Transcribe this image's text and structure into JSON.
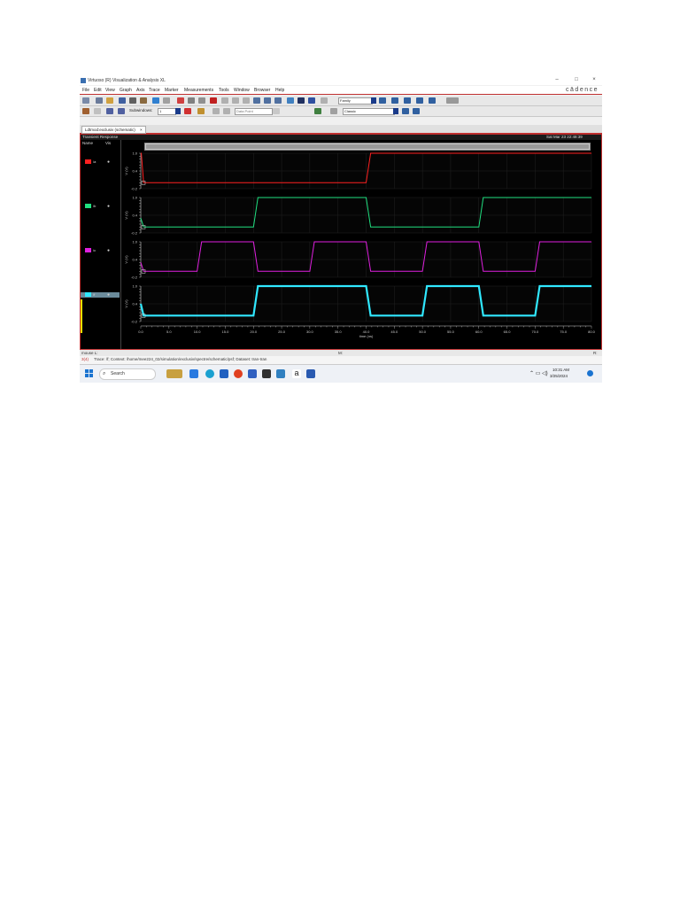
{
  "window": {
    "title": "Virtuoso (R) Visualization & Analysis XL",
    "controls": [
      "–",
      "□",
      "×"
    ]
  },
  "menu": {
    "items": [
      "File",
      "Edit",
      "View",
      "Graph",
      "Axis",
      "Trace",
      "Marker",
      "Measurements",
      "Tools",
      "Window",
      "Browser",
      "Help"
    ],
    "brand": "cādence"
  },
  "toolbar2": {
    "subwindows_label": "Subwindows:",
    "subwindows_value": "1",
    "point_placeholder": "Data Point",
    "family_value": "Family",
    "classic_value": "Classic"
  },
  "tab": {
    "label": "Ldtmod:exclusiv (schematic)",
    "close": "×"
  },
  "graph": {
    "title": "Transient Response",
    "timestamp": "Sat Mar 23 22:48:39",
    "side_headers": [
      "Name",
      "Vis"
    ],
    "x_label": "time (ns)",
    "x_ticks": [
      "0.0",
      "5.0",
      "10.0",
      "15.0",
      "20.0",
      "25.0",
      "30.0",
      "35.0",
      "40.0",
      "45.0",
      "50.0",
      "55.0",
      "60.0",
      "65.0",
      "70.0",
      "75.0",
      "80.0"
    ]
  },
  "chart_data": {
    "type": "line",
    "xlabel": "time (ns)",
    "xlim": [
      0,
      80
    ],
    "series": [
      {
        "name": "/a",
        "color": "#ff2020",
        "ylabel": "V (V)",
        "ylim": [
          -0.2,
          1.0
        ],
        "yticks": [
          "1.0",
          "0.4",
          "-0.2"
        ],
        "x": [
          0,
          0.1,
          0.5,
          40,
          40.8,
          80
        ],
        "y": [
          1.0,
          1.0,
          0.0,
          0.0,
          1.0,
          1.0
        ]
      },
      {
        "name": "/b",
        "color": "#20e080",
        "ylabel": "V (V)",
        "ylim": [
          -0.2,
          1.0
        ],
        "yticks": [
          "1.0",
          "0.4",
          "-0.2"
        ],
        "x": [
          0,
          0.5,
          20,
          20.8,
          40,
          40.8,
          60,
          60.8,
          80
        ],
        "y": [
          0.3,
          0.0,
          0.0,
          1.0,
          1.0,
          0.0,
          0.0,
          1.0,
          1.0
        ]
      },
      {
        "name": "/c",
        "color": "#e020e0",
        "ylabel": "V (V)",
        "ylim": [
          -0.2,
          1.0
        ],
        "yticks": [
          "1.0",
          "0.4",
          "-0.2"
        ],
        "x": [
          0,
          0.5,
          10,
          10.8,
          20,
          20.8,
          30,
          30.8,
          40,
          40.8,
          50,
          50.8,
          60,
          60.8,
          70,
          70.8,
          80
        ],
        "y": [
          0.3,
          0.0,
          0.0,
          1.0,
          1.0,
          0.0,
          0.0,
          1.0,
          1.0,
          0.0,
          0.0,
          1.0,
          1.0,
          0.0,
          0.0,
          1.0,
          1.0
        ]
      },
      {
        "name": "/f",
        "color": "#30e8ff",
        "ylabel": "V (V)",
        "ylim": [
          -0.2,
          1.0
        ],
        "yticks": [
          "1.0",
          "0.4",
          "-0.2"
        ],
        "x": [
          0,
          0.5,
          20,
          20.8,
          40,
          40.8,
          50,
          50.8,
          60,
          60.8,
          70,
          70.8,
          80
        ],
        "y": [
          0.4,
          0.0,
          0.0,
          1.0,
          1.0,
          0.0,
          0.0,
          1.0,
          1.0,
          0.0,
          0.0,
          1.0,
          1.0
        ]
      }
    ]
  },
  "status": {
    "left": "mouse L:",
    "middle": "M:",
    "right": "R:",
    "msg_num": "3(4)",
    "message": "Trace: /f; Context: /home/mee224_02/simulation/exclusiv/spectre/schematic/psf; Dataset: tran-tran"
  },
  "taskbar": {
    "search": "Search",
    "time": "10:31 AM",
    "date": "3/25/2024"
  }
}
